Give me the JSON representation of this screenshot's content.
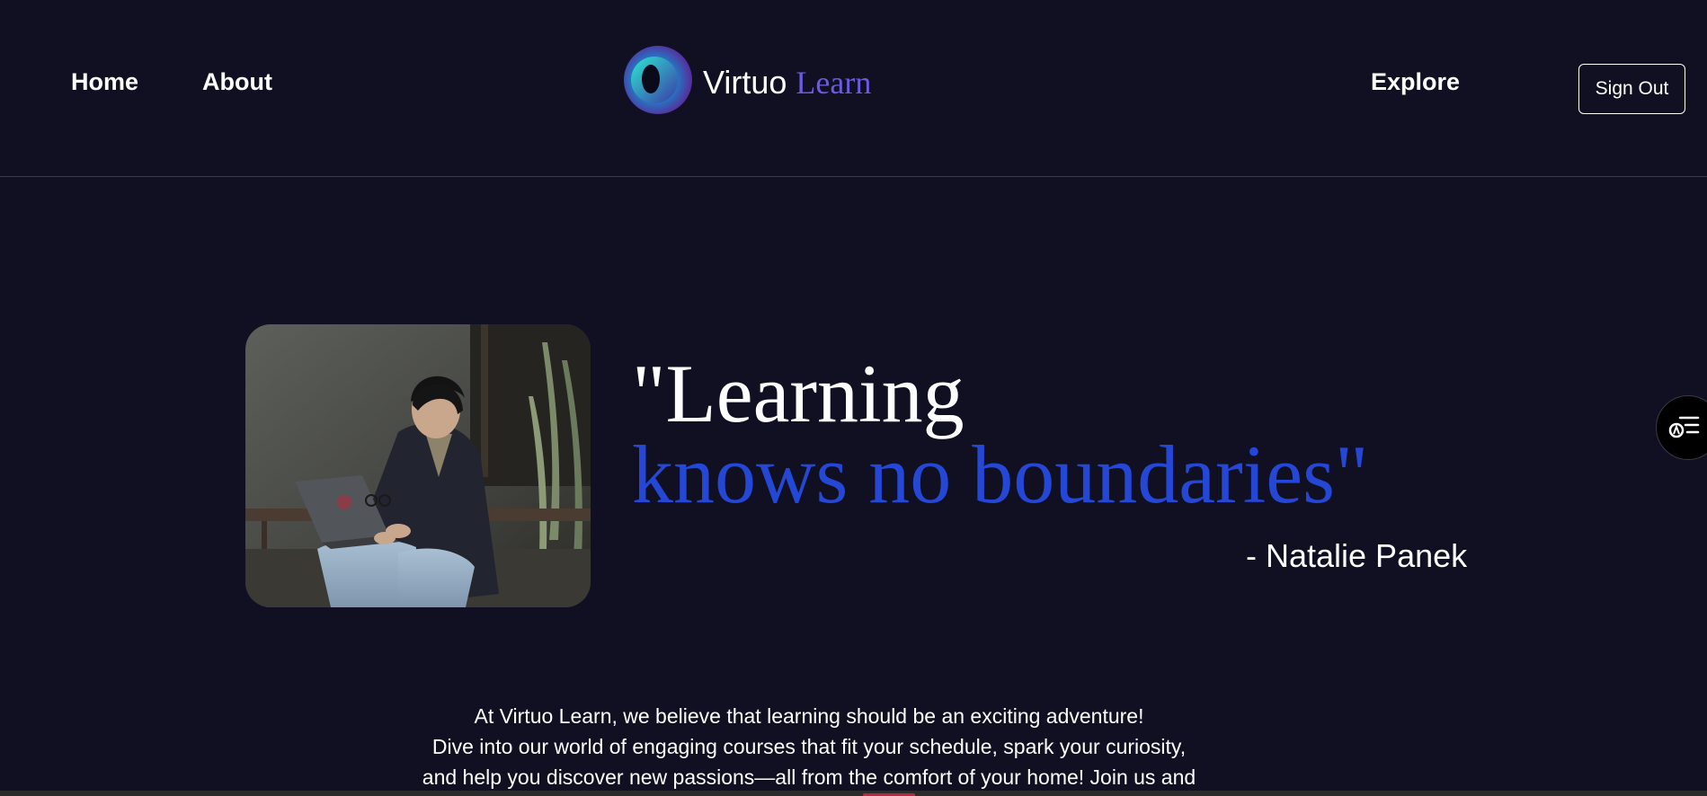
{
  "header": {
    "nav": {
      "home": "Home",
      "about": "About",
      "explore": "Explore"
    },
    "logo": {
      "virtuo": "Virtuo",
      "learn": "Learn",
      "icon": "logo-ring-icon"
    },
    "sign_out": "Sign Out"
  },
  "hero": {
    "quote_line1": "\"Learning",
    "quote_line2": "knows no boundaries\"",
    "author": "- Natalie Panek",
    "image": "student-with-laptop-photo"
  },
  "intro": {
    "line1": "At Virtuo Learn, we believe that learning should be an exciting adventure!",
    "line2": "Dive into our world of engaging courses that fit your schedule, spark your curiosity,",
    "line3": "and help you discover new passions—all from the comfort of your home! Join us and"
  },
  "side_widget": {
    "icon": "accessibility-menu-icon"
  },
  "colors": {
    "background": "#110f22",
    "accent_blue": "#2447d6",
    "logo_learn": "#6a5ce0",
    "text": "#ffffff"
  }
}
